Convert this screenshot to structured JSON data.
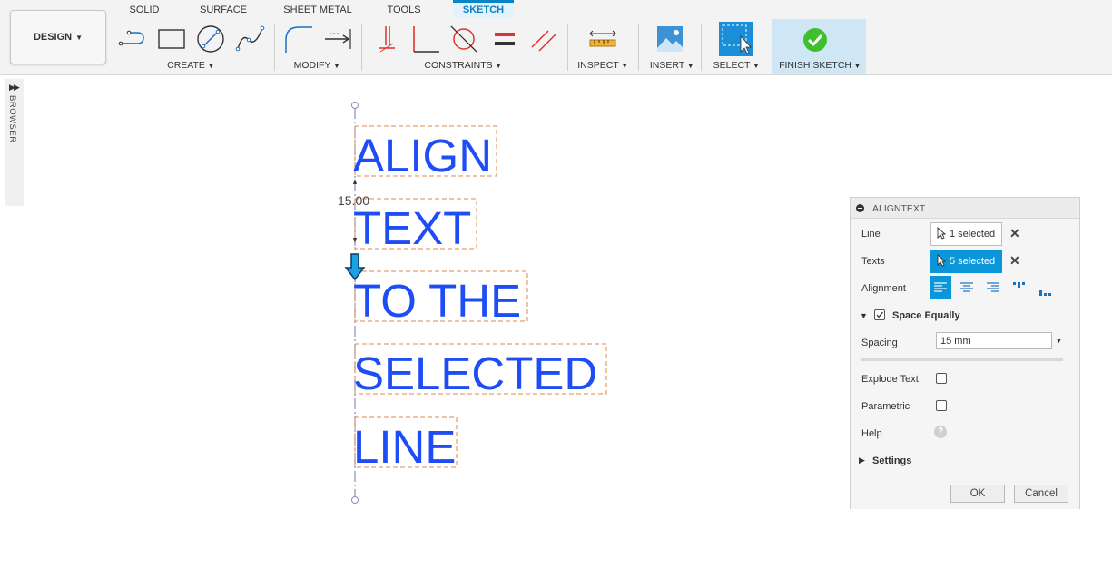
{
  "toolbar": {
    "design_label": "DESIGN",
    "tabs": [
      "SOLID",
      "SURFACE",
      "SHEET METAL",
      "TOOLS",
      "SKETCH"
    ],
    "active_tab": "SKETCH",
    "groups": {
      "create": "CREATE",
      "modify": "MODIFY",
      "constraints": "CONSTRAINTS",
      "inspect": "INSPECT",
      "insert": "INSERT",
      "select": "SELECT",
      "finish": "FINISH SKETCH"
    },
    "accent_color": "#0a84c9"
  },
  "browser": {
    "label": "BROWSER"
  },
  "canvas": {
    "texts": [
      "ALIGN",
      "TEXT",
      "TO THE",
      "SELECTED",
      "LINE"
    ],
    "dimension": "15.00",
    "text_color": "#1f4df5"
  },
  "panel": {
    "title": "ALIGNTEXT",
    "line_label": "Line",
    "line_value": "1 selected",
    "texts_label": "Texts",
    "texts_value": "5 selected",
    "alignment_label": "Alignment",
    "space_equally_label": "Space Equally",
    "space_equally_checked": true,
    "spacing_label": "Spacing",
    "spacing_value": "15 mm",
    "explode_label": "Explode Text",
    "explode_checked": false,
    "parametric_label": "Parametric",
    "parametric_checked": false,
    "help_label": "Help",
    "settings_label": "Settings",
    "ok_label": "OK",
    "cancel_label": "Cancel"
  }
}
